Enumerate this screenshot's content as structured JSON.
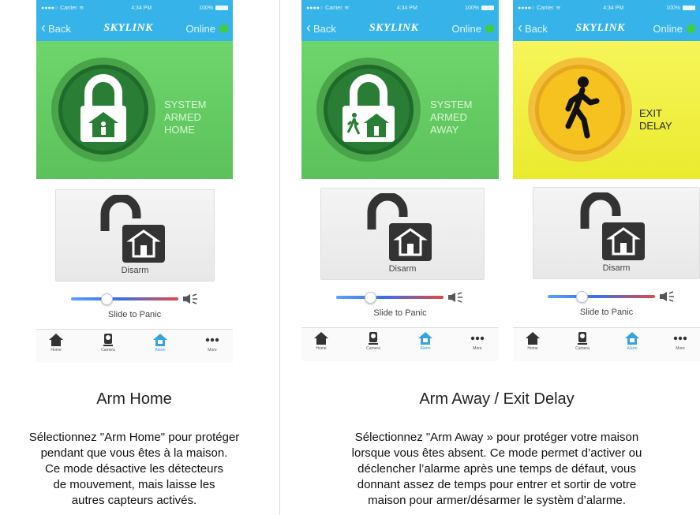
{
  "phones": [
    {
      "status": {
        "carrier": "Carrier",
        "time": "4:34 PM",
        "battery": "100%"
      },
      "nav": {
        "back": "Back",
        "logo": "SKYLINK",
        "online": "Online"
      },
      "status_lines": [
        "SYSTEM",
        "ARMED",
        "HOME"
      ],
      "disarm": "Disarm",
      "slider": "Slide to Panic",
      "tabs": [
        "Home",
        "Camera",
        "Alarm",
        "More"
      ]
    },
    {
      "status": {
        "carrier": "Carrier",
        "time": "4:34 PM",
        "battery": "100%"
      },
      "nav": {
        "back": "Back",
        "logo": "SKYLINK",
        "online": "Online"
      },
      "status_lines": [
        "SYSTEM",
        "ARMED",
        "AWAY"
      ],
      "disarm": "Disarm",
      "slider": "Slide to Panic",
      "tabs": [
        "Home",
        "Camera",
        "Alarm",
        "More"
      ]
    },
    {
      "status": {
        "carrier": "Carrier",
        "time": "4:34 PM",
        "battery": "100%"
      },
      "nav": {
        "back": "Back",
        "logo": "SKYLINK",
        "online": "Online"
      },
      "status_lines": [
        "EXIT",
        "DELAY"
      ],
      "disarm": "Disarm",
      "slider": "Slide to Panic",
      "tabs": [
        "Home",
        "Camera",
        "Alarm",
        "More"
      ]
    }
  ],
  "captions": [
    {
      "title": "Arm Home",
      "lines": [
        "Sélectionnez \"Arm Home\" pour protéger",
        "pendant que vous êtes à la maison.",
        "Ce mode désactive les détecteurs",
        "de mouvement, mais laisse les",
        "autres capteurs activés."
      ]
    },
    {
      "title": "Arm Away / Exit Delay",
      "lines": [
        "Sélectionnez \"Arm Away » pour protéger votre maison",
        "lorsque vous êtes absent. Ce mode permet d’activer ou",
        "déclencher l’alarme après une temps de défaut, vous",
        "donnant assez de temps pour entrer et sortir de votre",
        "maison pour armer/désarmer le systèm d’alarme."
      ]
    }
  ],
  "colors": {
    "nav": "#36b3e8",
    "armed": "#5cc15a",
    "exit_delay": "#eaea2e",
    "online": "#3fcc3f",
    "alarm_tab": "#36a3e0"
  }
}
